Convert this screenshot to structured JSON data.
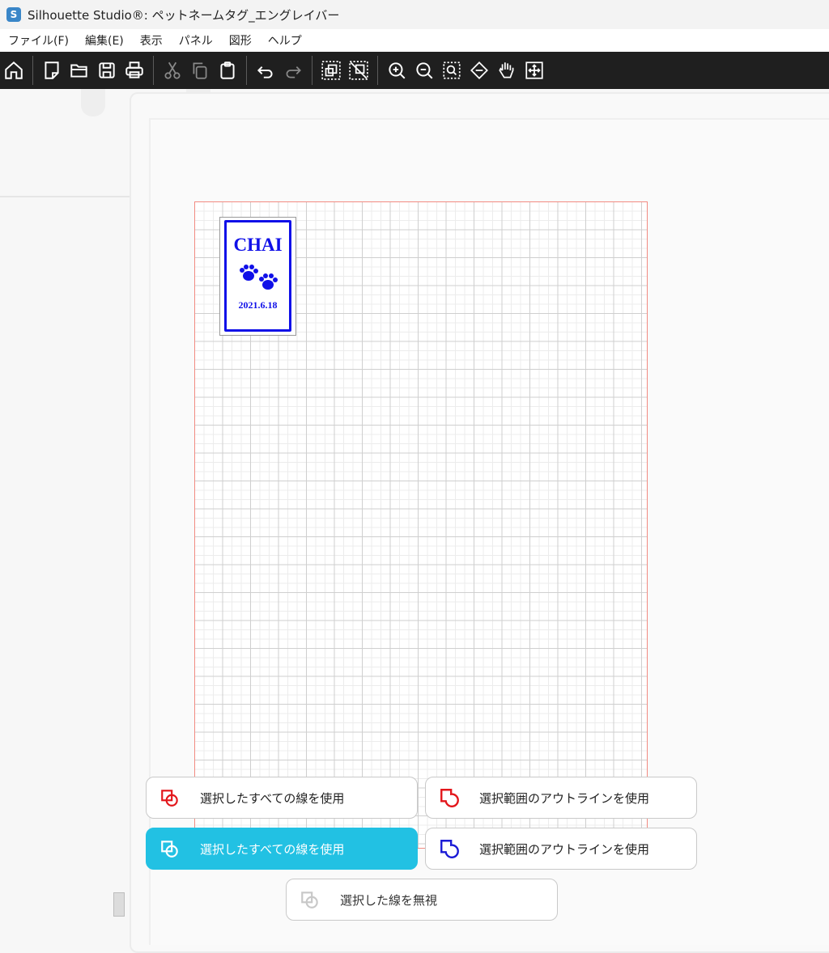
{
  "window": {
    "title": "Silhouette Studio®: ペットネームタグ_エングレイバー",
    "app_logo": "S"
  },
  "menu": [
    "ファイル(F)",
    "編集(E)",
    "表示",
    "パネル",
    "図形",
    "ヘルプ"
  ],
  "toolbar": {
    "icons": [
      "home-icon",
      "new-page-icon",
      "open-folder-icon",
      "save-icon",
      "print-icon",
      "cut-icon",
      "copy-icon",
      "paste-icon",
      "undo-icon",
      "redo-icon",
      "group-icon",
      "ungroup-icon",
      "zoom-in-icon",
      "zoom-out-icon",
      "zoom-selection-icon",
      "fit-page-icon",
      "pan-icon",
      "fit-window-icon"
    ]
  },
  "design": {
    "name": "CHAI",
    "date": "2021.6.18",
    "outline_color": "#1010e8",
    "cut_area_border_color": "#f28b82"
  },
  "options": [
    {
      "label": "選択したすべての線を使用",
      "icon": "cut-all-lines-red-icon",
      "active": false
    },
    {
      "label": "選択範囲のアウトラインを使用",
      "icon": "cut-outline-red-icon",
      "active": false
    },
    {
      "label": "選択したすべての線を使用",
      "icon": "cut-all-lines-white-icon",
      "active": true
    },
    {
      "label": "選択範囲のアウトラインを使用",
      "icon": "cut-outline-blue-icon",
      "active": false
    },
    {
      "label": "選択した線を無視",
      "icon": "ignore-lines-icon",
      "active": false
    }
  ],
  "colors": {
    "accent": "#22c1e3",
    "toolbar_bg": "#1f1f1f"
  }
}
